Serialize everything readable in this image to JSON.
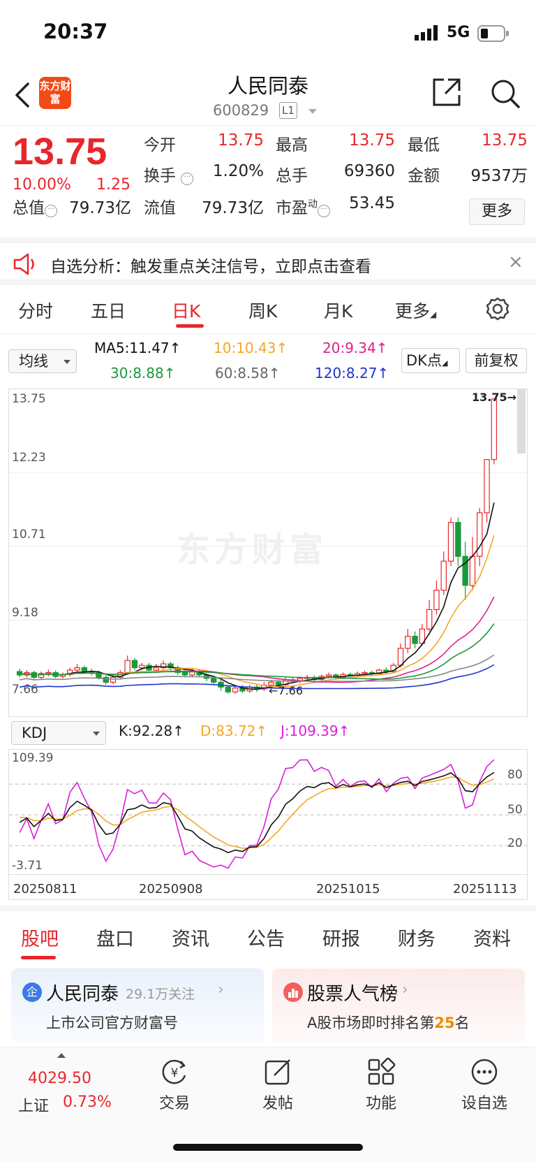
{
  "status": {
    "time": "20:37",
    "network": "5G"
  },
  "nav": {
    "logo": "东方财富",
    "name": "人民同泰",
    "code": "600829",
    "level": "L1"
  },
  "quote": {
    "price": "13.75",
    "pct": "10.00%",
    "change": "1.25",
    "fields": {
      "open_l": "今开",
      "open_v": "13.75",
      "high_l": "最高",
      "high_v": "13.75",
      "low_l": "最低",
      "low_v": "13.75",
      "turn_l": "换手",
      "turn_v": "1.20%",
      "vol_l": "总手",
      "vol_v": "69360",
      "amt_l": "金额",
      "amt_v": "9537万",
      "mcap_l": "总值",
      "mcap_v": "79.73亿",
      "float_l": "流值",
      "float_v": "79.73亿",
      "pe_l": "市盈",
      "pe_sup": "动",
      "pe_v": "53.45"
    },
    "more": "更多"
  },
  "notice": {
    "text": "自选分析：触发重点关注信号，立即点击查看"
  },
  "period_tabs": [
    "分时",
    "五日",
    "日K",
    "周K",
    "月K",
    "更多"
  ],
  "ma": {
    "selector": "均线",
    "ma5": "MA5:11.47",
    "ma10": "10:10.43",
    "ma20": "20:9.34",
    "ma30": "30:8.88",
    "ma60": "60:8.58",
    "ma120": "120:8.27",
    "dk": "DK点",
    "fq": "前复权",
    "arrow": "↑",
    "colors": {
      "ma5": "#111111",
      "ma10": "#f5a623",
      "ma20": "#e0208a",
      "ma30": "#1a9a3a",
      "ma60": "#888888",
      "ma120": "#2233cc"
    }
  },
  "kdj": {
    "selector": "KDJ",
    "k": "K:92.28",
    "d": "D:83.72",
    "j": "J:109.39",
    "arrow": "↑",
    "ymax": "109.39",
    "ymin": "-3.71",
    "l80": "80",
    "l50": "50",
    "l20": "20"
  },
  "dates": [
    "20250811",
    "20250908",
    "20251015",
    "20251113"
  ],
  "content_tabs": [
    "股吧",
    "盘口",
    "资讯",
    "公告",
    "研报",
    "财务",
    "资料"
  ],
  "cards": {
    "company": {
      "badge": "企",
      "name": "人民同泰",
      "follow": "29.1万关注",
      "sub": "上市公司官方财富号"
    },
    "rank": {
      "title": "股票人气榜",
      "sub_pre": "A股市场即时排名第",
      "rank": "25",
      "sub_post": "名"
    }
  },
  "bottom": {
    "index_val": "4029.50",
    "index_name": "上证",
    "index_pct": "0.73%",
    "trade": "交易",
    "post": "发帖",
    "func": "功能",
    "watch": "设自选"
  },
  "chart_data": {
    "type": "candlestick",
    "watermark": "东方财富",
    "price_max_label": "13.75",
    "price_min_label": "7.66",
    "y_ticks": [
      "13.75",
      "12.23",
      "10.71",
      "9.18",
      "7.66"
    ],
    "ylim": [
      7.66,
      13.75
    ],
    "candles": [
      [
        8.12,
        8.05,
        8.18,
        8.0
      ],
      [
        8.05,
        8.1,
        8.15,
        8.0
      ],
      [
        8.1,
        8.0,
        8.14,
        7.95
      ],
      [
        8.0,
        8.08,
        8.12,
        7.96
      ],
      [
        8.08,
        8.1,
        8.16,
        8.02
      ],
      [
        8.1,
        8.02,
        8.14,
        7.98
      ],
      [
        8.02,
        8.06,
        8.1,
        7.98
      ],
      [
        8.06,
        8.15,
        8.2,
        8.02
      ],
      [
        8.15,
        8.2,
        8.28,
        8.1
      ],
      [
        8.2,
        8.12,
        8.24,
        8.08
      ],
      [
        8.12,
        8.1,
        8.18,
        8.04
      ],
      [
        8.1,
        8.0,
        8.14,
        7.96
      ],
      [
        8.0,
        7.9,
        8.04,
        7.85
      ],
      [
        7.9,
        8.0,
        8.05,
        7.86
      ],
      [
        8.0,
        8.1,
        8.15,
        7.98
      ],
      [
        8.1,
        8.35,
        8.45,
        8.06
      ],
      [
        8.35,
        8.2,
        8.4,
        8.15
      ],
      [
        8.2,
        8.25,
        8.3,
        8.15
      ],
      [
        8.25,
        8.15,
        8.3,
        8.1
      ],
      [
        8.15,
        8.2,
        8.28,
        8.12
      ],
      [
        8.2,
        8.28,
        8.35,
        8.16
      ],
      [
        8.28,
        8.2,
        8.32,
        8.14
      ],
      [
        8.2,
        8.1,
        8.24,
        8.05
      ],
      [
        8.1,
        8.05,
        8.15,
        8.0
      ],
      [
        8.05,
        8.12,
        8.18,
        8.0
      ],
      [
        8.12,
        8.05,
        8.16,
        8.0
      ],
      [
        8.05,
        7.98,
        8.08,
        7.92
      ],
      [
        7.98,
        7.9,
        8.02,
        7.85
      ],
      [
        7.9,
        7.8,
        7.95,
        7.72
      ],
      [
        7.8,
        7.7,
        7.84,
        7.66
      ],
      [
        7.7,
        7.78,
        7.82,
        7.66
      ],
      [
        7.78,
        7.72,
        7.84,
        7.68
      ],
      [
        7.72,
        7.8,
        7.85,
        7.68
      ],
      [
        7.8,
        7.76,
        7.86,
        7.7
      ],
      [
        7.76,
        7.84,
        7.9,
        7.72
      ],
      [
        7.84,
        7.9,
        7.95,
        7.8
      ],
      [
        7.9,
        7.85,
        7.96,
        7.8
      ],
      [
        7.85,
        7.95,
        8.0,
        7.82
      ],
      [
        7.95,
        7.92,
        8.0,
        7.88
      ],
      [
        7.92,
        7.98,
        8.02,
        7.88
      ],
      [
        7.98,
        8.0,
        8.05,
        7.94
      ],
      [
        8.0,
        7.96,
        8.04,
        7.92
      ],
      [
        7.96,
        8.02,
        8.06,
        7.92
      ],
      [
        8.02,
        8.05,
        8.1,
        7.98
      ],
      [
        8.05,
        8.0,
        8.08,
        7.96
      ],
      [
        8.0,
        8.06,
        8.1,
        7.98
      ],
      [
        8.06,
        8.04,
        8.1,
        8.0
      ],
      [
        8.04,
        8.08,
        8.12,
        8.0
      ],
      [
        8.08,
        8.1,
        8.14,
        8.04
      ],
      [
        8.1,
        8.08,
        8.14,
        8.04
      ],
      [
        8.08,
        8.15,
        8.18,
        8.04
      ],
      [
        8.15,
        8.12,
        8.2,
        8.08
      ],
      [
        8.12,
        8.25,
        8.3,
        8.1
      ],
      [
        8.25,
        8.6,
        8.7,
        8.2
      ],
      [
        8.6,
        8.85,
        9.0,
        8.5
      ],
      [
        8.85,
        8.7,
        8.95,
        8.6
      ],
      [
        8.7,
        9.0,
        9.1,
        8.65
      ],
      [
        9.0,
        9.4,
        9.6,
        8.95
      ],
      [
        9.4,
        9.8,
        10.0,
        9.3
      ],
      [
        9.8,
        10.4,
        10.6,
        9.7
      ],
      [
        10.4,
        11.2,
        11.3,
        10.3
      ],
      [
        11.2,
        10.5,
        11.3,
        10.3
      ],
      [
        10.5,
        9.9,
        10.8,
        9.6
      ],
      [
        9.9,
        10.5,
        10.9,
        9.8
      ],
      [
        10.5,
        11.4,
        11.5,
        10.3
      ],
      [
        11.4,
        12.5,
        12.5,
        11.2
      ],
      [
        12.5,
        13.75,
        13.75,
        12.4
      ]
    ],
    "kdj_ylim": [
      -3.71,
      109.39
    ]
  }
}
